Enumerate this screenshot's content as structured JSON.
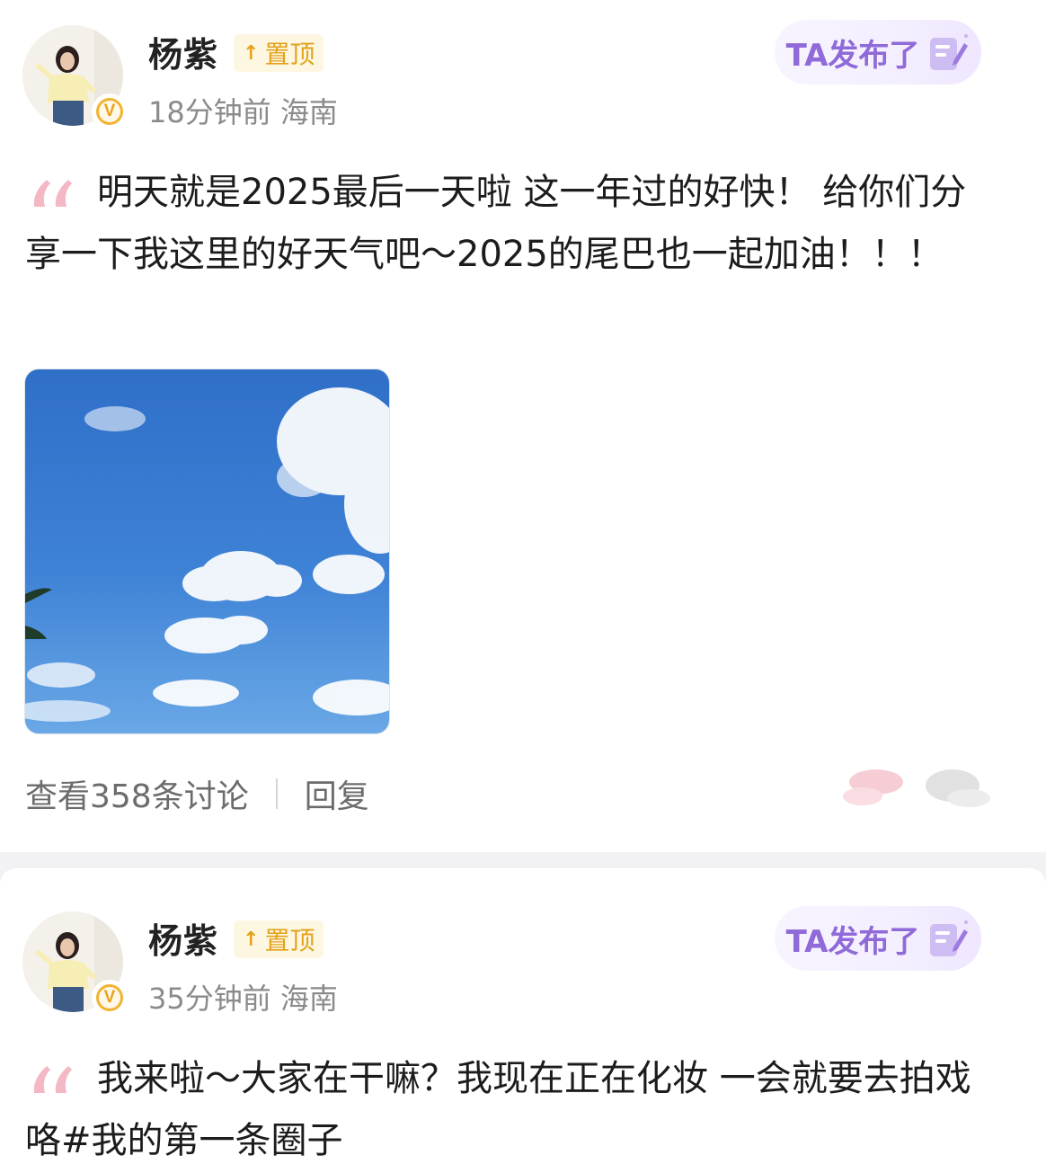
{
  "posts": [
    {
      "author": "杨紫",
      "pin_label": "置顶",
      "time": "18分钟前",
      "location": "海南",
      "ta_label": "TA发布了",
      "text": "明天就是2025最后一天啦 这一年过的好快！ 给你们分享一下我这里的好天气吧～2025的尾巴也一起加油！！！",
      "discussion": "查看358条讨论",
      "reply": "回复",
      "icons": {
        "verified": "verified-v-icon",
        "pin": "up-arrow-icon",
        "ta": "edit-document-icon",
        "quote": "quote-mark-icon"
      },
      "verified_letter": "V"
    },
    {
      "author": "杨紫",
      "pin_label": "置顶",
      "time": "35分钟前",
      "location": "海南",
      "ta_label": "TA发布了",
      "text": "我来啦～大家在干嘛？我现在正在化妆 一会就要去拍戏咯#我的第一条圈子",
      "verified_letter": "V"
    }
  ],
  "colors": {
    "pin": "#e2a21a",
    "ta_badge_text": "#8f6ad8",
    "verified": "#f2b233",
    "quote": "#f3b9c3",
    "meta_text": "#8b8b8b"
  }
}
